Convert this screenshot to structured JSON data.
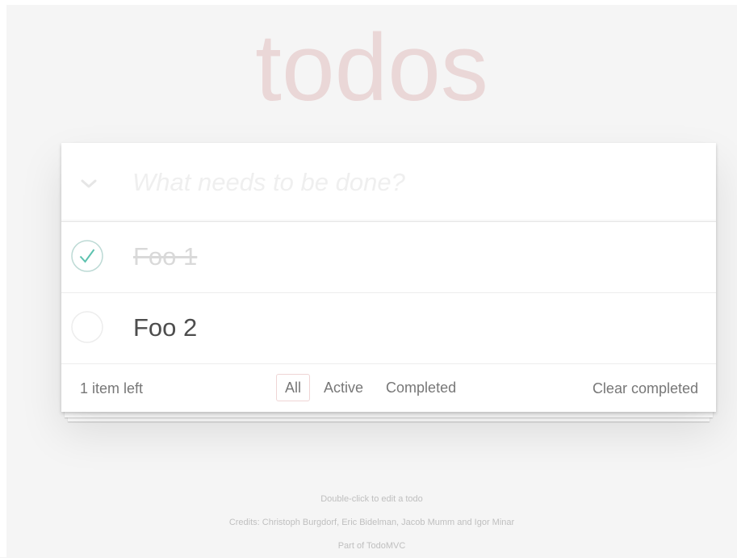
{
  "app": {
    "title": "todos"
  },
  "new_todo": {
    "placeholder": "What needs to be done?",
    "value": ""
  },
  "todos": [
    {
      "label": "Foo 1",
      "completed": true
    },
    {
      "label": "Foo 2",
      "completed": false
    }
  ],
  "footer": {
    "count_text": "1 item left",
    "filters": [
      {
        "label": "All",
        "selected": true
      },
      {
        "label": "Active",
        "selected": false
      },
      {
        "label": "Completed",
        "selected": false
      }
    ],
    "clear_completed_label": "Clear completed"
  },
  "info": {
    "hint": "Double-click to edit a todo",
    "credits": "Credits: Christoph Burgdorf, Eric Bidelman, Jacob Mumm and Igor Minar",
    "part_of": "Part of TodoMVC"
  },
  "icons": {
    "toggle_all": "chevron-down-icon",
    "completed_check": "checkmark-circle-icon",
    "empty_check": "empty-circle-icon"
  },
  "colors": {
    "title": "#efd5d5",
    "check_stroke": "#5dc2af",
    "selected_filter_border": "#e9caca"
  }
}
